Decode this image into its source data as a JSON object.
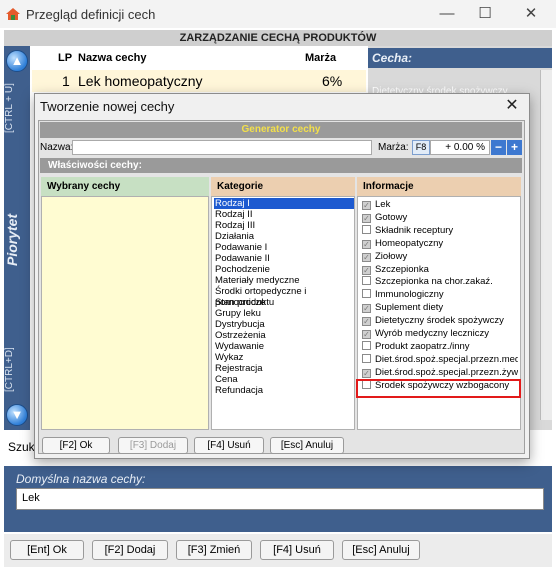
{
  "window": {
    "title": "Przegląd definicji cech",
    "minimize": "—",
    "maximize": "☐",
    "close": "✕"
  },
  "header": {
    "title": "ZARZĄDZANIE CECHĄ PRODUKTÓW"
  },
  "side": {
    "top_hint": "[CTRL + U]",
    "priority": "Piorytet",
    "bottom_hint": "[CTRL+D]",
    "up_icon": "arrow-up-icon",
    "down_icon": "arrow-down-icon"
  },
  "list": {
    "headers": {
      "lp": "LP",
      "name": "Nazwa cechy",
      "margin": "Marża"
    },
    "rows": [
      {
        "lp": "1",
        "name": "Lek homeopatyczny",
        "margin": "6%"
      }
    ]
  },
  "right_panel": {
    "label": "Cecha:",
    "preview": "Dietetyczny środek spożywczy"
  },
  "search": {
    "label": "Szuka"
  },
  "default_name": {
    "label": "Domyślna nazwa cechy:",
    "value": "Lek"
  },
  "bottom_buttons": [
    "[Ent] Ok",
    "[F2] Dodaj",
    "[F3] Zmień",
    "[F4] Usuń",
    "[Esc] Anuluj"
  ],
  "dialog": {
    "title": "Tworzenie nowej cechy",
    "close": "✕",
    "generator_title": "Generator cechy",
    "name_label": "Nazwa:",
    "name_value": "",
    "margin_label": "Marża:",
    "margin_key": "F8",
    "margin_value": "+ 0.00 %",
    "minus": "−",
    "plus": "+",
    "properties_title": "Właściwości cechy:",
    "columns": {
      "selected": "Wybrany cechy",
      "categories": "Kategorie",
      "info": "Informacje"
    },
    "categories": [
      "Rodzaj I",
      "Rodzaj II",
      "Rodzaj III",
      "Działania",
      "Podawanie I",
      "Podawanie II",
      "Pochodzenie",
      "Materiały medyczne",
      "Środki ortopedyczne i pomocnicze",
      "Stan produktu",
      "Grupy leku",
      "Dystrybucja",
      "Ostrzeżenia",
      "Wydawanie",
      "Wykaz",
      "Rejestracja",
      "Cena",
      "Refundacja"
    ],
    "selected_category": 0,
    "info_items": [
      {
        "label": "Lek",
        "checked": true
      },
      {
        "label": "Gotowy",
        "checked": true
      },
      {
        "label": "Składnik receptury",
        "checked": false
      },
      {
        "label": "Homeopatyczny",
        "checked": true
      },
      {
        "label": "Ziołowy",
        "checked": true
      },
      {
        "label": "Szczepionka",
        "checked": true
      },
      {
        "label": "Szczepionka na chor.zakaź.",
        "checked": false
      },
      {
        "label": "Immunologiczny",
        "checked": false
      },
      {
        "label": "Suplement diety",
        "checked": true
      },
      {
        "label": "Dietetyczny środek spożywczy",
        "checked": true
      },
      {
        "label": "Wyrób medyczny leczniczy",
        "checked": true
      },
      {
        "label": "Produkt zaopatrz./inny",
        "checked": false
      },
      {
        "label": "Diet.środ.spoż.specjal.przezn.med.",
        "checked": false
      },
      {
        "label": "Diet.środ.spoż.specjal.przezn.żyw.",
        "checked": true
      },
      {
        "label": "Środek spożywczy wzbogacony",
        "checked": false
      }
    ],
    "buttons": [
      {
        "label": "[F2] Ok",
        "disabled": false
      },
      {
        "label": "[F3] Dodaj",
        "disabled": true
      },
      {
        "label": "[F4] Usuń",
        "disabled": false
      },
      {
        "label": "[Esc] Anuluj",
        "disabled": false
      }
    ]
  }
}
